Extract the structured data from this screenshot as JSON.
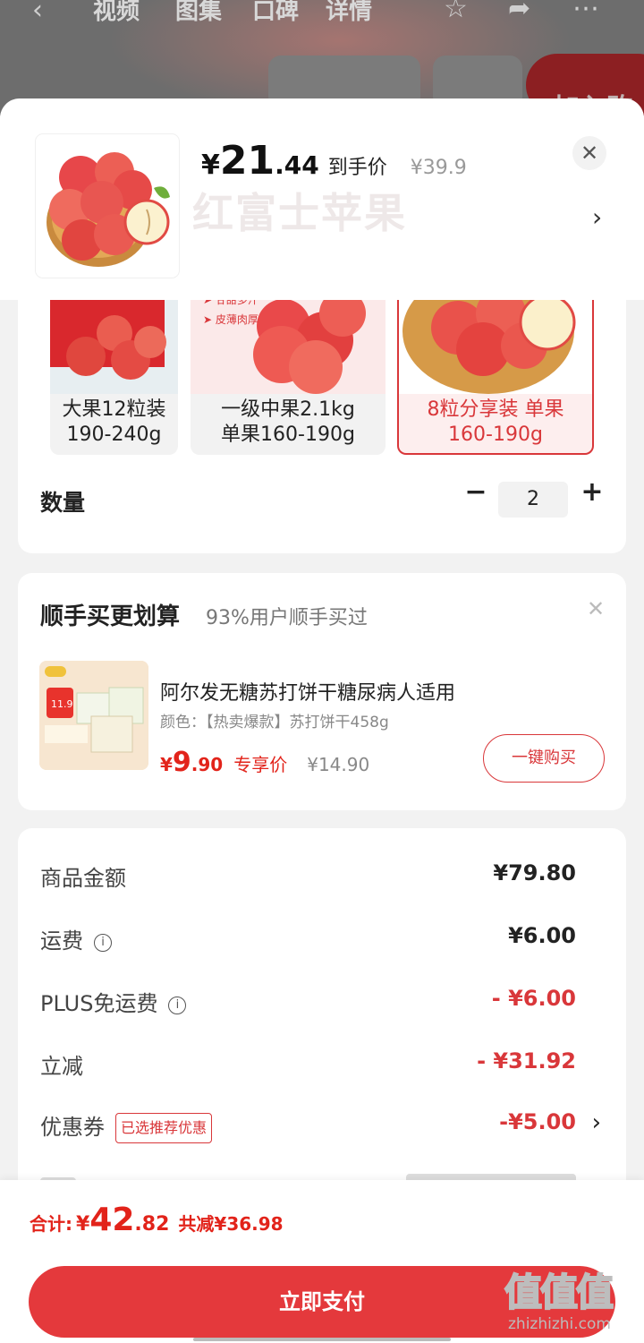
{
  "background": {
    "tabs": [
      "视频",
      "图集",
      "口碑",
      "详情"
    ],
    "cart_text": "加入购"
  },
  "header": {
    "price_yen": "¥",
    "price_int": "21",
    "price_dec": ".44",
    "price_label": "到手价",
    "original_price": "¥39.9",
    "faded_title": "红富士苹果"
  },
  "specs": [
    {
      "line1": "大果12粒装",
      "line2": "190-240g",
      "selected": false
    },
    {
      "line1": "一级中果2.1kg",
      "line2": "单果160-190g",
      "selected": false
    },
    {
      "line1": "8粒分享装  单果",
      "line2": "160-190g",
      "selected": true
    }
  ],
  "spec_badges": [
    "甘甜多汁",
    "皮薄肉厚"
  ],
  "quantity": {
    "label": "数量",
    "value": "2",
    "minus": "−",
    "plus": "+"
  },
  "addon": {
    "title": "顺手买更划算",
    "subtitle": "93%用户顺手买过",
    "product_name": "阿尔发无糖苏打饼干糖尿病人适用",
    "attr": "颜色：【热卖爆款】苏打饼干458g",
    "price_yen": "¥",
    "price_int": "9",
    "price_dec": ".90",
    "price_tag": "专享价",
    "original_price": "¥14.90",
    "buy_label": "一键购买",
    "img_label": "11.9"
  },
  "summary": [
    {
      "label": "商品金额",
      "value": "¥79.80",
      "red": false,
      "info": false
    },
    {
      "label": "运费",
      "value": "¥6.00",
      "red": false,
      "info": true
    },
    {
      "label": "PLUS免运费",
      "value": "- ¥6.00",
      "red": true,
      "info": true
    },
    {
      "label": "立减",
      "value": "- ¥31.92",
      "red": true,
      "info": false
    },
    {
      "label": "优惠券",
      "value": "-¥5.00",
      "red": true,
      "info": false,
      "badge": "已选推荐优惠",
      "chevron": true
    }
  ],
  "bottom": {
    "total_label": "合计:",
    "total_yen": "¥",
    "total_int": "42",
    "total_dec": ".82",
    "saved": "共减¥36.98",
    "pay_label": "立即支付"
  },
  "watermark": {
    "logo": "值值值",
    "url": "zhizhizhi.com"
  },
  "colors": {
    "accent": "#e4393c",
    "price_red": "#e2231a"
  }
}
